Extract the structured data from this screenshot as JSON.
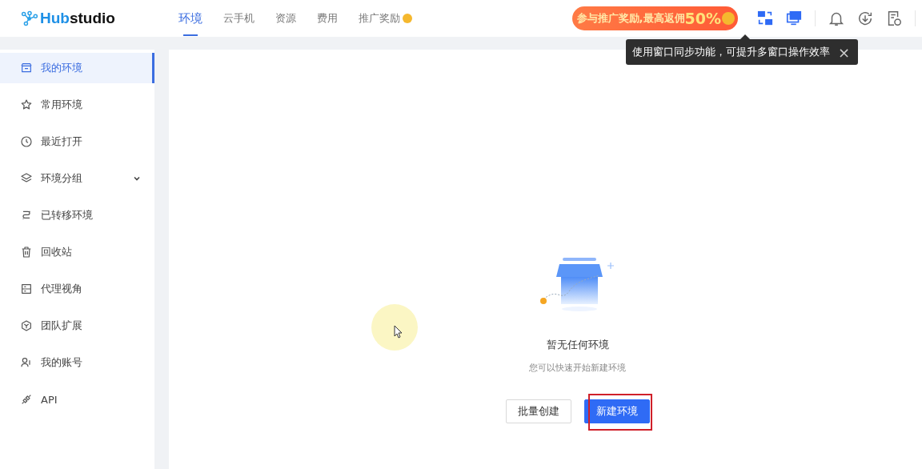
{
  "header": {
    "logo": {
      "accent": "Hub",
      "rest": "studio"
    },
    "nav": [
      {
        "label": "环境",
        "selected": true
      },
      {
        "label": "云手机",
        "selected": false
      },
      {
        "label": "资源",
        "selected": false
      },
      {
        "label": "费用",
        "selected": false
      },
      {
        "label": "推广奖励",
        "selected": false,
        "coin": true
      }
    ],
    "promo": {
      "text": "参与推广奖励,最高返佣",
      "highlight": "50%"
    }
  },
  "tooltip": {
    "text": "使用窗口同步功能，可提升多窗口操作效率",
    "close": "×"
  },
  "sidebar": {
    "items": [
      {
        "label": "我的环境",
        "selected": true,
        "kind": "link"
      },
      {
        "label": "常用环境",
        "selected": false,
        "kind": "link"
      },
      {
        "label": "最近打开",
        "selected": false,
        "kind": "link"
      },
      {
        "label": "环境分组",
        "selected": false,
        "kind": "group"
      },
      {
        "label": "已转移环境",
        "selected": false,
        "kind": "link"
      },
      {
        "label": "回收站",
        "selected": false,
        "kind": "link"
      },
      {
        "label": "代理视角",
        "selected": false,
        "kind": "link"
      },
      {
        "label": "团队扩展",
        "selected": false,
        "kind": "link"
      },
      {
        "label": "我的账号",
        "selected": false,
        "kind": "link"
      },
      {
        "label": "API",
        "selected": false,
        "kind": "link"
      }
    ]
  },
  "empty_state": {
    "title": "暂无任何环境",
    "subtitle": "您可以快速开始新建环境",
    "buttons": [
      {
        "label": "批量创建",
        "kind": "secondary",
        "highlighted": false
      },
      {
        "label": "新建环境",
        "kind": "primary",
        "highlighted": true
      }
    ]
  }
}
